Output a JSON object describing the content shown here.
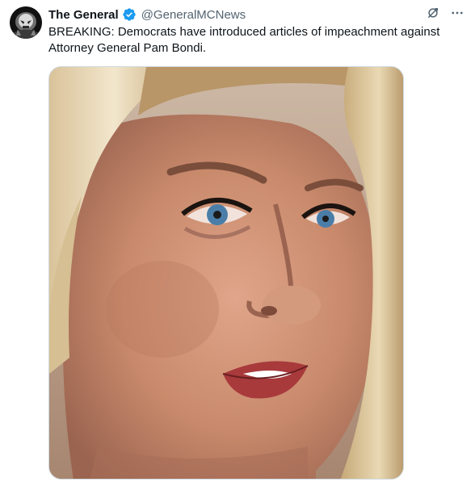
{
  "tweet": {
    "display_name": "The General",
    "handle": "@GeneralMCNews",
    "text_line1": "BREAKING: Democrats have introduced articles of impeachment against",
    "text_line2": "Attorney General Pam Bondi.",
    "verified_color": "#1d9bf0",
    "icons": {
      "verified": "verified-badge-icon",
      "grok": "grok-icon",
      "more": "more-horizontal-icon"
    }
  },
  "colors": {
    "text": "#0f1419",
    "secondary": "#536471",
    "border": "#cfd9de"
  }
}
